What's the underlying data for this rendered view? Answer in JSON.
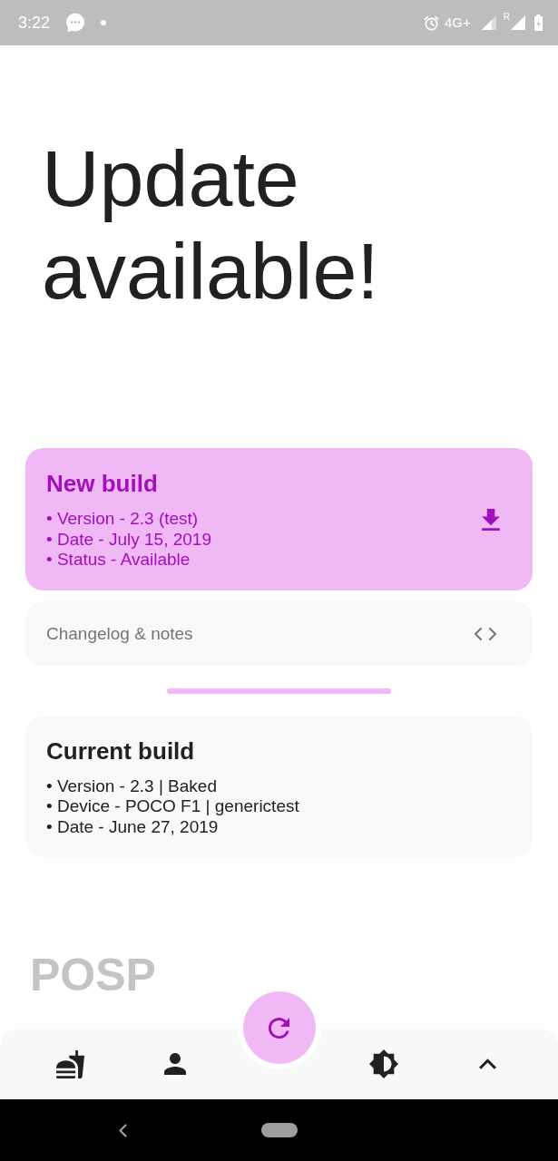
{
  "status_bar": {
    "time": "3:22",
    "network_type": "4G+",
    "roaming": "R"
  },
  "heading": "Update available!",
  "new_build": {
    "title": "New build",
    "details": [
      "• Version - 2.3 (test)",
      "• Date - July 15, 2019",
      "• Status - Available"
    ]
  },
  "changelog": {
    "label": "Changelog & notes"
  },
  "current_build": {
    "title": "Current build",
    "details": [
      "• Version - 2.3 | Baked",
      "• Device - POCO F1 | generictest",
      "• Date - June 27, 2019"
    ]
  },
  "logo": {
    "text": "POSP"
  }
}
